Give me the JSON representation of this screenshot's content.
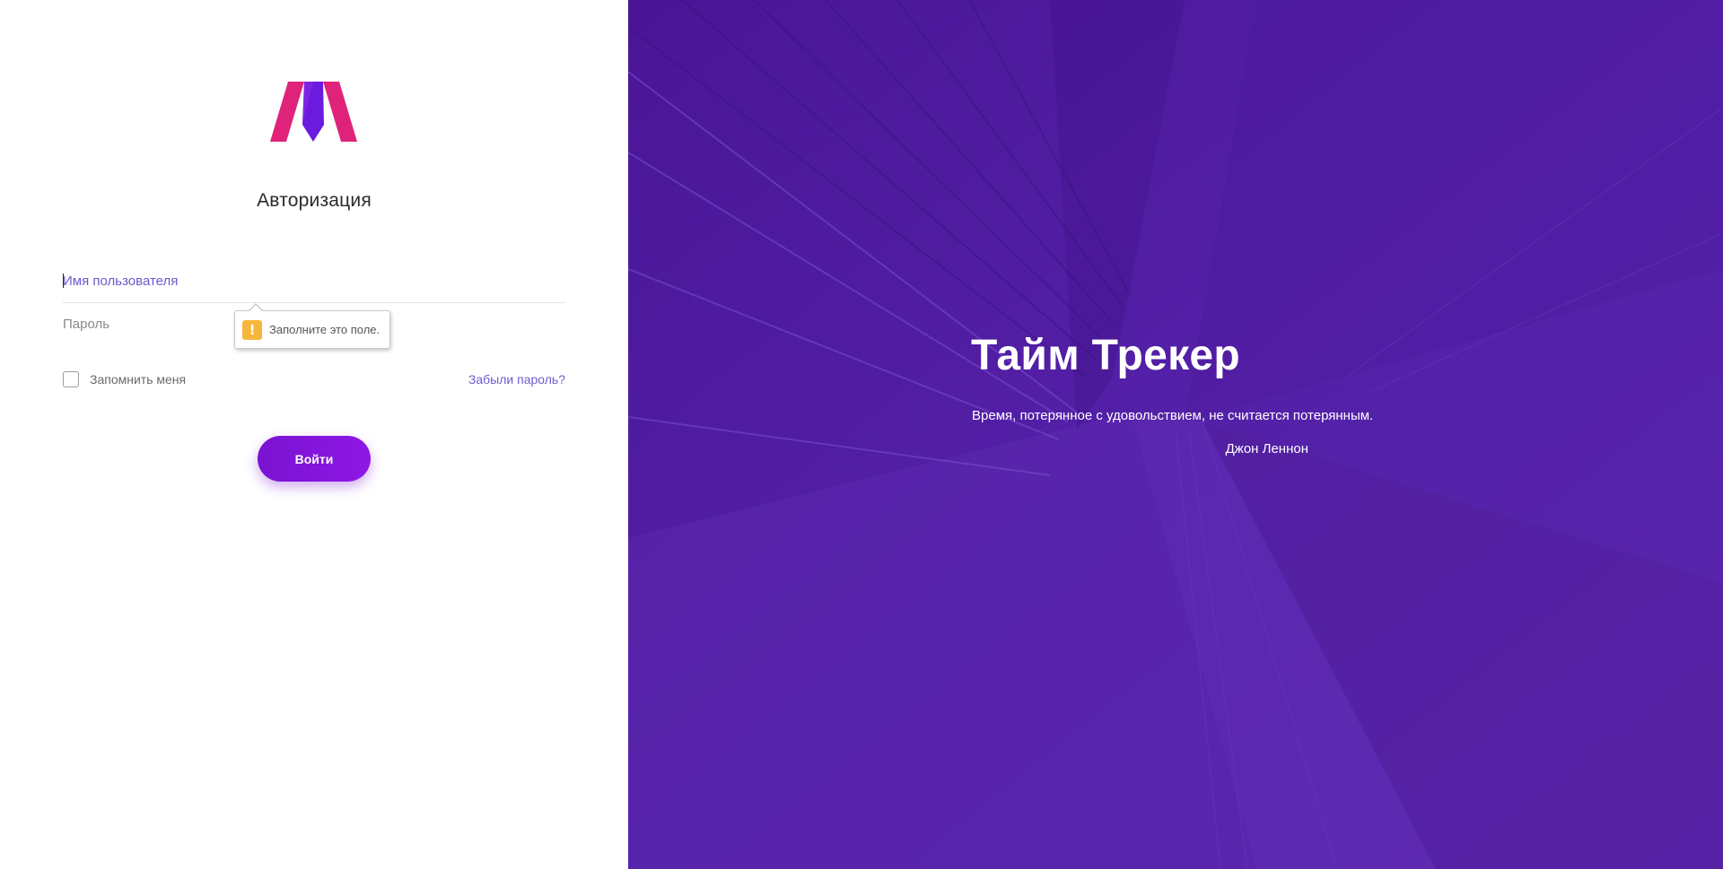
{
  "login": {
    "title": "Авторизация",
    "username_placeholder": "Имя пользователя",
    "password_placeholder": "Пароль",
    "remember_label": "Запомнить меня",
    "forgot_link": "Забыли пароль?",
    "submit_label": "Войти",
    "validation_tooltip": "Заполните это поле."
  },
  "hero": {
    "title": "Тайм Трекер",
    "quote": "Время, потерянное с удовольствием, не считается потерянным.",
    "author": "Джон Леннон"
  },
  "icons": {
    "logo": "brand-logo-icon",
    "warning": "warning-icon"
  },
  "colors": {
    "accent": "#7a13d2",
    "link": "#6f5bd0",
    "hero_background": "#4f1aa0",
    "logo_pink": "#e0237a",
    "logo_purple": "#6b1ae0",
    "warning": "#f6b63c"
  }
}
